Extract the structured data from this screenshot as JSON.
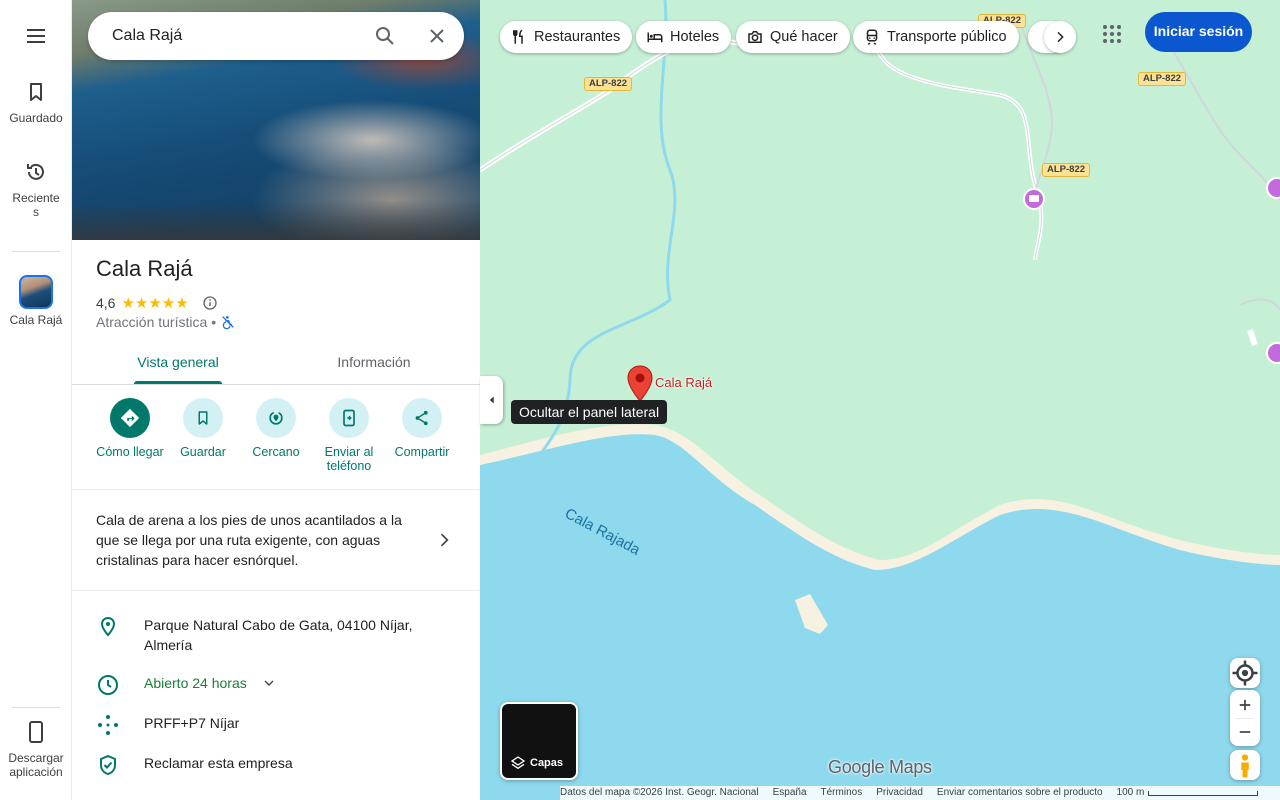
{
  "rail": {
    "saved": "Guardado",
    "recent_line1": "Reciente",
    "recent_line2": "s",
    "place": "Cala Rajá",
    "download_line1": "Descargar",
    "download_line2": "aplicación"
  },
  "search": {
    "value": "Cala Rajá"
  },
  "place": {
    "title": "Cala Rajá",
    "rating": "4,6",
    "stars": "★★★★★",
    "category": "Atracción turística",
    "separator": "•"
  },
  "tabs": [
    {
      "label": "Vista general"
    },
    {
      "label": "Información"
    }
  ],
  "actions": [
    {
      "label": "Cómo llegar"
    },
    {
      "label": "Guardar"
    },
    {
      "label": "Cercano"
    },
    {
      "label_line1": "Enviar al",
      "label_line2": "teléfono"
    },
    {
      "label": "Compartir"
    }
  ],
  "description": "Cala de arena a los pies de unos acantilados a la que se llega por una ruta exigente, con aguas cristalinas para hacer esnórquel.",
  "info": {
    "address": "Parque Natural Cabo de Gata, 04100 Níjar, Almería",
    "hours": "Abierto 24 horas",
    "plus_code": "PRFF+P7 Níjar",
    "claim": "Reclamar esta empresa"
  },
  "map": {
    "chips": [
      {
        "label": "Restaurantes",
        "icon": "fork-knife-icon"
      },
      {
        "label": "Hoteles",
        "icon": "bed-icon"
      },
      {
        "label": "Qué hacer",
        "icon": "camera-icon"
      },
      {
        "label": "Transporte público",
        "icon": "train-icon"
      }
    ],
    "signin": "Iniciar sesión",
    "road_badge": "ALP-822",
    "pin_label": "Cala Rajá",
    "water_label": "Cala Rajada",
    "tooltip": "Ocultar el panel lateral",
    "layers": "Capas",
    "logo": "Google Maps",
    "footer": {
      "data": "Datos del mapa ©2026 Inst. Geogr. Nacional",
      "country": "España",
      "terms": "Términos",
      "privacy": "Privacidad",
      "feedback": "Enviar comentarios sobre el producto",
      "scale": "100 m"
    }
  },
  "colors": {
    "accent": "#00796b",
    "signin": "#0b57d0",
    "land": "#c6f0d6",
    "water": "#8fd9ee",
    "sand": "#f6f1e1",
    "pin": "#ea4335",
    "star": "#fbbc04"
  }
}
